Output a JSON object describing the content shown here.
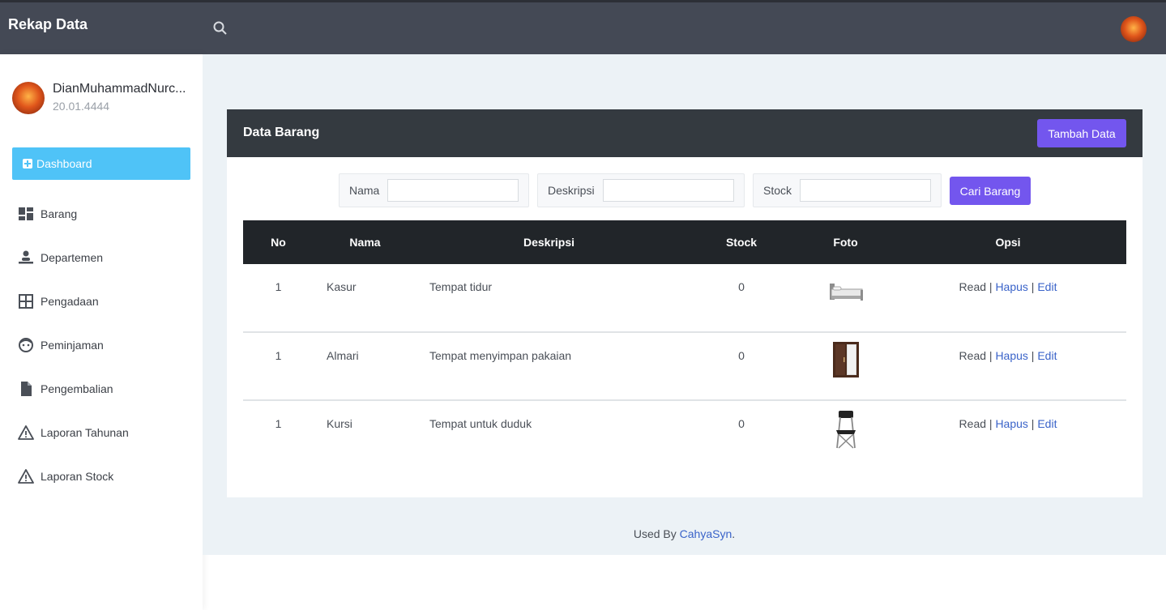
{
  "app": {
    "brand": "Rekap Data"
  },
  "user": {
    "name": "DianMuhammadNurc...",
    "id": "20.01.4444"
  },
  "sidebar": {
    "active": "Dashboard",
    "items": [
      {
        "label": "Barang",
        "icon": "dashboard-grid-icon"
      },
      {
        "label": "Departemen",
        "icon": "person-desk-icon"
      },
      {
        "label": "Pengadaan",
        "icon": "grid-icon"
      },
      {
        "label": "Peminjaman",
        "icon": "face-icon"
      },
      {
        "label": "Pengembalian",
        "icon": "file-icon"
      },
      {
        "label": "Laporan Tahunan",
        "icon": "warning-icon"
      },
      {
        "label": "Laporan Stock",
        "icon": "warning-icon"
      }
    ]
  },
  "card": {
    "title": "Data Barang",
    "add_label": "Tambah Data"
  },
  "filters": {
    "nama_label": "Nama",
    "nama_value": "",
    "deskripsi_label": "Deskripsi",
    "deskripsi_value": "",
    "stock_label": "Stock",
    "stock_value": "",
    "search_label": "Cari Barang"
  },
  "table": {
    "headers": [
      "No",
      "Nama",
      "Deskripsi",
      "Stock",
      "Foto",
      "Opsi"
    ],
    "rows": [
      {
        "no": "1",
        "nama": "Kasur",
        "deskripsi": "Tempat tidur",
        "stock": "0",
        "foto": "bed-image"
      },
      {
        "no": "1",
        "nama": "Almari",
        "deskripsi": "Tempat menyimpan pakaian",
        "stock": "0",
        "foto": "wardrobe-image"
      },
      {
        "no": "1",
        "nama": "Kursi",
        "deskripsi": "Tempat untuk duduk",
        "stock": "0",
        "foto": "chair-image"
      }
    ],
    "actions": {
      "read": "Read",
      "sep": "|",
      "hapus": "Hapus",
      "edit": "Edit"
    }
  },
  "footer": {
    "prefix": "Used By ",
    "link": "CahyaSyn",
    "suffix": "."
  },
  "colors": {
    "topbar": "#444955",
    "accent_active": "#4fc3f7",
    "button": "#7356ee",
    "table_head": "#212529",
    "link": "#3a63c9"
  }
}
